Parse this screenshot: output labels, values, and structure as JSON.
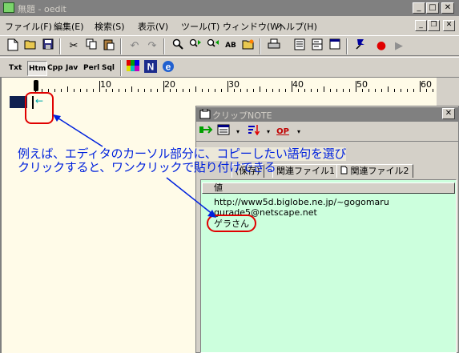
{
  "window": {
    "title": "無題 - oedit",
    "controls": {
      "minimize": "_",
      "maximize": "□",
      "close": "✕"
    }
  },
  "menu": [
    {
      "label": "ファイル(F)",
      "name": "file"
    },
    {
      "label": "編集(E)",
      "name": "edit"
    },
    {
      "label": "検索(S)",
      "name": "search"
    },
    {
      "label": "表示(V)",
      "name": "view"
    },
    {
      "label": "ツール(T)",
      "name": "tools"
    },
    {
      "label": "ウィンドウ(W)",
      "name": "window"
    },
    {
      "label": "ヘルプ(H)",
      "name": "help"
    }
  ],
  "mdi_controls": {
    "minimize": "_",
    "restore": "❐",
    "close": "✕"
  },
  "toolbar": {
    "icons": [
      "new-file-icon",
      "open-folder-icon",
      "save-icon",
      "cut-icon",
      "copy-icon",
      "paste-icon",
      "undo-icon",
      "redo-icon",
      "search-icon",
      "search-next-icon",
      "search-prev-icon",
      "replace-icon",
      "open-files-icon",
      "print-icon",
      "list-icon",
      "split-icon",
      "window-icon",
      "bookmark-icon",
      "record-icon",
      "play-icon"
    ]
  },
  "language_tabs": [
    {
      "label": "Txt",
      "active": false
    },
    {
      "label": "Htm",
      "active": true
    },
    {
      "label": "Cpp",
      "active": false
    },
    {
      "label": "Jav",
      "active": false
    },
    {
      "label": "Perl",
      "active": false
    },
    {
      "label": "Sql",
      "active": false
    }
  ],
  "ruler": {
    "numbers": [
      "10",
      "20",
      "30",
      "40",
      "50",
      "60"
    ]
  },
  "editor": {
    "eol_glyph": "←"
  },
  "clip_note": {
    "title": "クリップNOTE",
    "close": "✕",
    "tabs": [
      {
        "label": "(保存)"
      },
      {
        "label": "関連ファイル1"
      },
      {
        "label": "関連ファイル2"
      }
    ],
    "column_header": "値",
    "rows": [
      "http://www5d.biglobe.ne.jp/~gogomaru",
      "gurade5@netscape.net",
      "ゲラさん"
    ]
  },
  "annotation": {
    "line1": "例えば、エディタのカーソル部分に、コピーしたい語句を選び",
    "line2": "クリックすると、ワンクリックで貼り付けできる"
  },
  "colors": {
    "editor_bg": "#fffbe8",
    "list_bg": "#ccffdd",
    "annotation": "#0022dd",
    "highlight_ring": "#e00000"
  }
}
